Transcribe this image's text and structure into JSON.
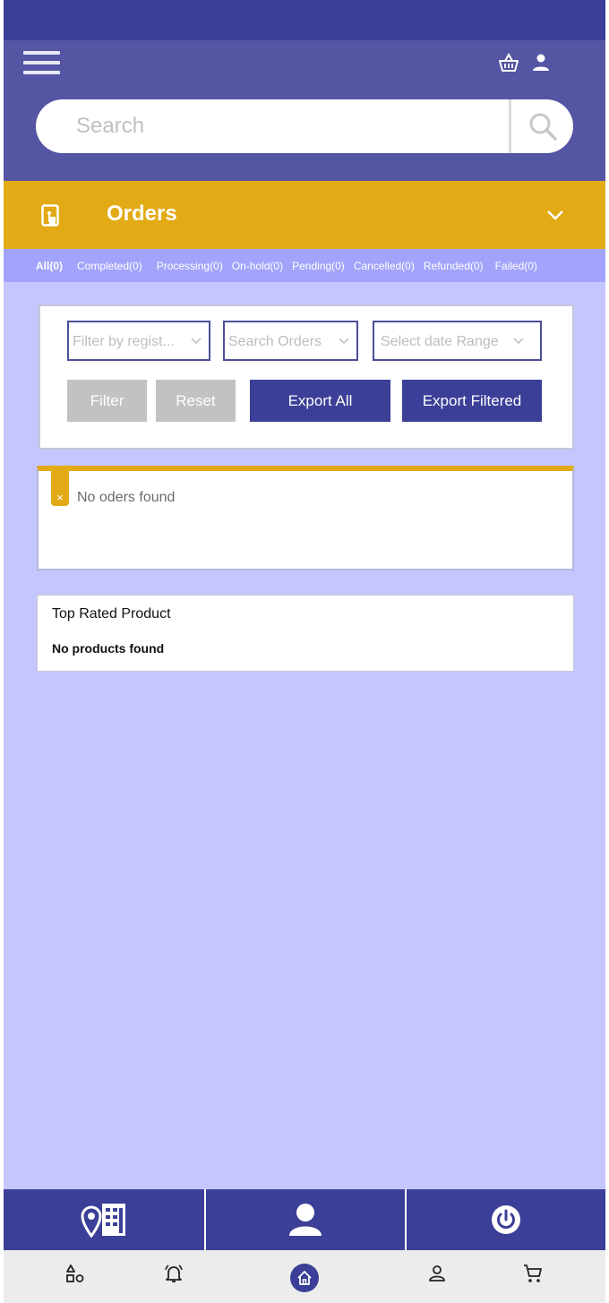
{
  "header": {
    "menu_icon": "hamburger-icon",
    "icons": [
      "basket-icon",
      "user-icon"
    ]
  },
  "search": {
    "placeholder": "Search",
    "button_icon": "search-icon"
  },
  "orders_section": {
    "icon": "orders-icon",
    "title": "Orders",
    "expand_icon": "chevron-down-icon"
  },
  "tabs": [
    {
      "label": "All(0)",
      "active": true
    },
    {
      "label": "Completed(0)"
    },
    {
      "label": "Processing(0)"
    },
    {
      "label": "On-hold(0)"
    },
    {
      "label": "Pending(0)"
    },
    {
      "label": "Cancelled(0)"
    },
    {
      "label": "Refunded(0)"
    },
    {
      "label": "Failed(0)"
    }
  ],
  "filters": {
    "registration_placeholder": "Filter by regist...",
    "search_orders_placeholder": "Search Orders",
    "date_range_placeholder": "Select date Range",
    "filter_label": "Filter",
    "reset_label": "Reset",
    "export_all_label": "Export All",
    "export_filtered_label": "Export Filtered"
  },
  "orders_result": {
    "close_symbol": "×",
    "message": "No oders found"
  },
  "top_rated": {
    "title": "Top Rated Product",
    "message": "No products found"
  },
  "action_bar": {
    "icons": [
      "store-location-icon",
      "profile-icon",
      "power-icon"
    ]
  },
  "bottom_nav": {
    "icons": [
      "categories-icon",
      "notifications-icon",
      "home-icon",
      "account-icon",
      "cart-icon"
    ]
  },
  "colors": {
    "status_bar": "#3b3f97",
    "header": "#5455a3",
    "accent": "#e2aa15",
    "tabs_bg": "#a2a4fb",
    "page_bg": "#c5c6fd",
    "navy": "#3b3f97",
    "gray_button": "#c2c2c2"
  }
}
